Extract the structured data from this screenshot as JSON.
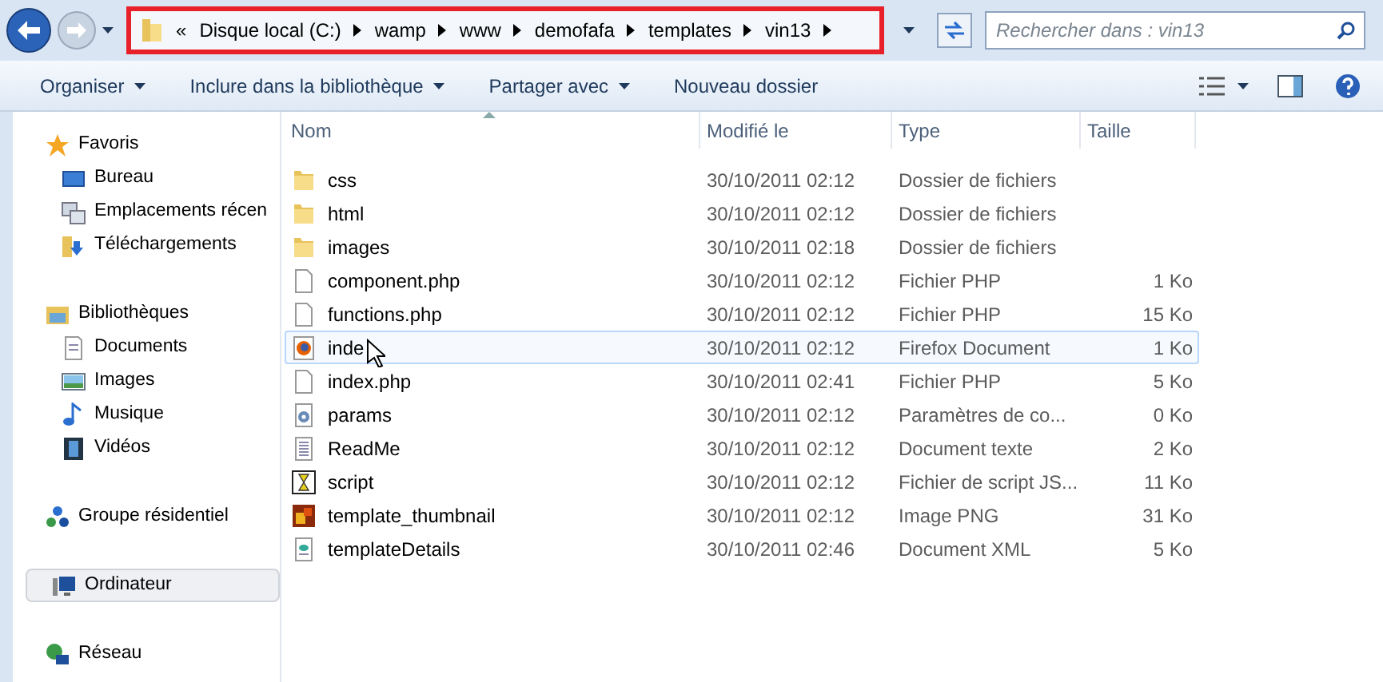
{
  "address_bar": {
    "overflow": "«",
    "highlighted": true,
    "crumbs": [
      "Disque local (C:)",
      "wamp",
      "www",
      "demofafa",
      "templates",
      "vin13"
    ]
  },
  "search": {
    "placeholder": "Rechercher dans : vin13"
  },
  "toolbar": [
    {
      "label": "Organiser",
      "dropdown": true
    },
    {
      "label": "Inclure dans la bibliothèque",
      "dropdown": true
    },
    {
      "label": "Partager avec",
      "dropdown": true
    },
    {
      "label": "Nouveau dossier",
      "dropdown": false
    }
  ],
  "sidebar": [
    {
      "label": "Favoris",
      "kind": "star",
      "selected": false,
      "children": [
        {
          "label": "Bureau",
          "kind": "desktop",
          "selected": false
        },
        {
          "label": "Emplacements récen",
          "kind": "recent",
          "selected": false
        },
        {
          "label": "Téléchargements",
          "kind": "download",
          "selected": false
        }
      ]
    },
    {
      "label": "Bibliothèques",
      "kind": "library",
      "selected": false,
      "children": [
        {
          "label": "Documents",
          "kind": "document",
          "selected": false
        },
        {
          "label": "Images",
          "kind": "image",
          "selected": false
        },
        {
          "label": "Musique",
          "kind": "music",
          "selected": false
        },
        {
          "label": "Vidéos",
          "kind": "video",
          "selected": false
        }
      ]
    },
    {
      "label": "Groupe résidentiel",
      "kind": "homegroup",
      "selected": false
    },
    {
      "label": "Ordinateur",
      "kind": "computer",
      "selected": true
    },
    {
      "label": "Réseau",
      "kind": "network",
      "selected": false
    }
  ],
  "columns": [
    "Nom",
    "Modifié le",
    "Type",
    "Taille"
  ],
  "files": [
    {
      "name": "css",
      "modified": "30/10/2011 02:12",
      "type": "Dossier de fichiers",
      "kind": "folder",
      "hovered": false
    },
    {
      "name": "html",
      "modified": "30/10/2011 02:12",
      "type": "Dossier de fichiers",
      "kind": "folder",
      "hovered": false
    },
    {
      "name": "images",
      "modified": "30/10/2011 02:18",
      "type": "Dossier de fichiers",
      "kind": "folder",
      "hovered": false
    },
    {
      "name": "component.php",
      "modified": "30/10/2011 02:12",
      "type": "Fichier PHP",
      "size": "1 Ko",
      "kind": "php",
      "hovered": false
    },
    {
      "name": "functions.php",
      "modified": "30/10/2011 02:12",
      "type": "Fichier PHP",
      "size": "15 Ko",
      "kind": "php",
      "hovered": false
    },
    {
      "name": "inde",
      "modified": "30/10/2011 02:12",
      "type": "Firefox Document",
      "size": "1 Ko",
      "kind": "firefox",
      "hovered": true
    },
    {
      "name": "index.php",
      "modified": "30/10/2011 02:41",
      "type": "Fichier PHP",
      "size": "5 Ko",
      "kind": "php",
      "hovered": false
    },
    {
      "name": "params",
      "modified": "30/10/2011 02:12",
      "type": "Paramètres de co...",
      "size": "0 Ko",
      "kind": "settings",
      "hovered": false
    },
    {
      "name": "ReadMe",
      "modified": "30/10/2011 02:12",
      "type": "Document texte",
      "size": "2 Ko",
      "kind": "text",
      "hovered": false
    },
    {
      "name": "script",
      "modified": "30/10/2011 02:12",
      "type": "Fichier de script JS...",
      "size": "11 Ko",
      "kind": "script",
      "hovered": false
    },
    {
      "name": "template_thumbnail",
      "modified": "30/10/2011 02:12",
      "type": "Image PNG",
      "size": "31 Ko",
      "kind": "png",
      "hovered": false
    },
    {
      "name": "templateDetails",
      "modified": "30/10/2011 02:46",
      "type": "Document XML",
      "size": "5 Ko",
      "kind": "xml",
      "hovered": false
    }
  ]
}
